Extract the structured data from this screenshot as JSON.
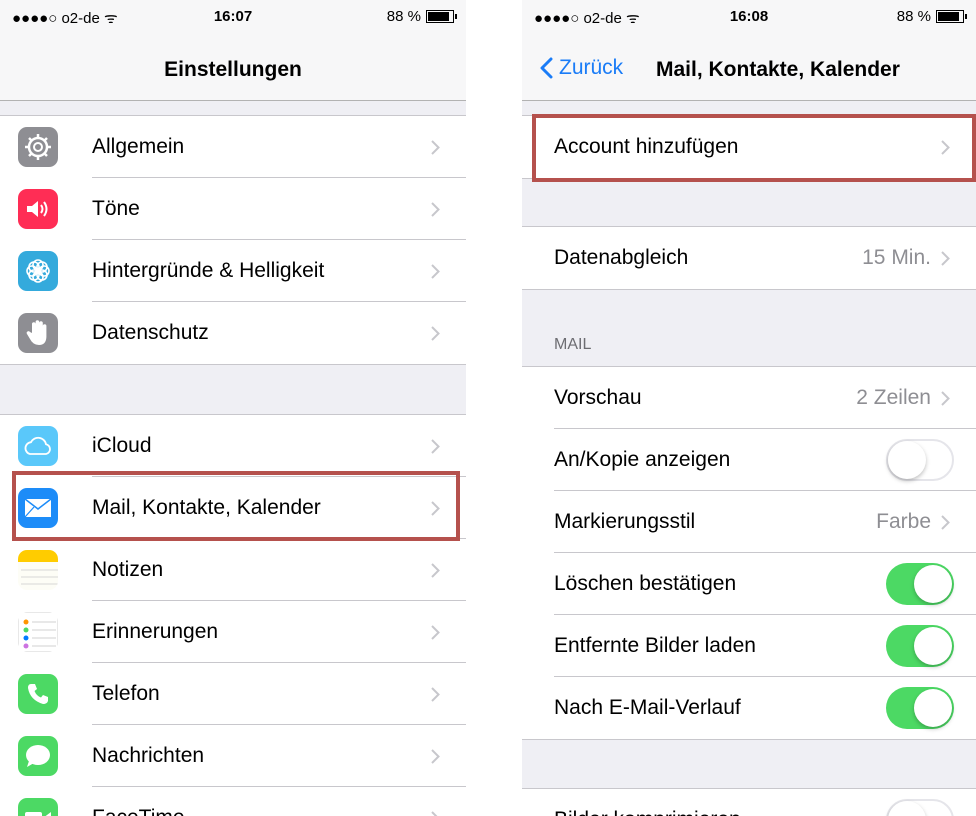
{
  "left": {
    "status": {
      "carrier": "●●●●○ o2-de ᯤ",
      "time": "16:07",
      "battery": "88 %"
    },
    "nav": {
      "title": "Einstellungen"
    },
    "group1": [
      {
        "label": "Allgemein",
        "icon": "gear-icon",
        "color": "#8e8e93"
      },
      {
        "label": "Töne",
        "icon": "speaker-icon",
        "color": "#ff2d55"
      },
      {
        "label": "Hintergründe & Helligkeit",
        "icon": "flower-icon",
        "color": "#34aadc"
      },
      {
        "label": "Datenschutz",
        "icon": "hand-icon",
        "color": "#8e8e93"
      }
    ],
    "group2": [
      {
        "label": "iCloud",
        "icon": "cloud-icon",
        "color": "#5ac8fa"
      },
      {
        "label": "Mail, Kontakte, Kalender",
        "icon": "mail-icon",
        "color": "#1d8cf8"
      },
      {
        "label": "Notizen",
        "icon": "notes-icon",
        "color": "#ffcc00"
      },
      {
        "label": "Erinnerungen",
        "icon": "reminders-icon",
        "color": "#ffffff"
      },
      {
        "label": "Telefon",
        "icon": "phone-icon",
        "color": "#4cd964"
      },
      {
        "label": "Nachrichten",
        "icon": "messages-icon",
        "color": "#4cd964"
      },
      {
        "label": "FaceTime",
        "icon": "facetime-icon",
        "color": "#4cd964"
      }
    ]
  },
  "right": {
    "status": {
      "carrier": "●●●●○ o2-de ᯤ",
      "time": "16:08",
      "battery": "88 %"
    },
    "nav": {
      "back": "Zurück",
      "title": "Mail, Kontakte, Kalender"
    },
    "add_account": "Account hinzufügen",
    "fetch": {
      "label": "Datenabgleich",
      "value": "15 Min."
    },
    "mail_header": "MAIL",
    "mail_rows": [
      {
        "label": "Vorschau",
        "value": "2 Zeilen",
        "type": "value"
      },
      {
        "label": "An/Kopie anzeigen",
        "type": "toggle",
        "on": false
      },
      {
        "label": "Markierungsstil",
        "value": "Farbe",
        "type": "value"
      },
      {
        "label": "Löschen bestätigen",
        "type": "toggle",
        "on": true
      },
      {
        "label": "Entfernte Bilder laden",
        "type": "toggle",
        "on": true
      },
      {
        "label": "Nach E-Mail-Verlauf",
        "type": "toggle",
        "on": true
      }
    ],
    "next_row": {
      "label": "Bilder komprimieren",
      "type": "toggle",
      "on": false
    }
  },
  "colors": {
    "accent": "#1a7cf7",
    "highlight": "#b5514d",
    "toggle_on": "#4cd964"
  }
}
